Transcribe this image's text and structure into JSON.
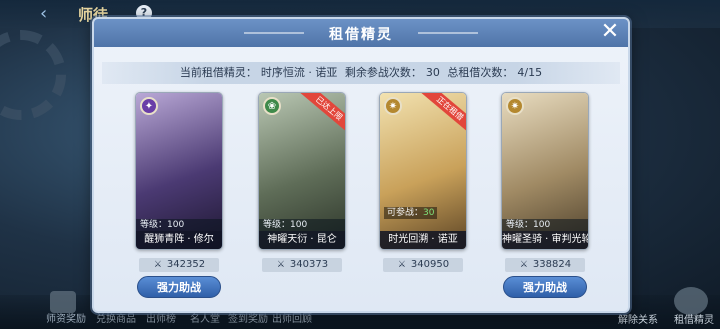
{
  "background": {
    "title": "师徒",
    "help": "?",
    "back_glyph": "‹",
    "bottom_items": [
      "师资奖励",
      "兑换商品",
      "出师榜",
      "名人堂",
      "签到奖励",
      "出师回顾"
    ],
    "right_label": "租借精灵",
    "right_label2": "解除关系"
  },
  "dialog": {
    "title": "租借精灵",
    "close": "✕",
    "info": {
      "current_label": "当前租借精灵：",
      "current_value": "时序恒流 · 诺亚",
      "remaining_label": "剩余参战次数：",
      "remaining_value": "30",
      "total_label": "总租借次数：",
      "total_value": "4/15"
    }
  },
  "cards": [
    {
      "name": "醒狮青阵 · 修尔",
      "level": "等级：100",
      "power": "342352",
      "element_icon": "shadow-element-icon",
      "element_color": "#6a3ea8",
      "element_glyph": "✦",
      "art_colors": [
        "#b9a8d6",
        "#4b3a73",
        "#1d1730"
      ],
      "ribbon": "",
      "can_battle": "",
      "can_battle_value": "",
      "button": "强力助战"
    },
    {
      "name": "神曜天衍 · 昆仑",
      "level": "等级：100",
      "power": "340373",
      "element_icon": "nature-element-icon",
      "element_color": "#3f8a4a",
      "element_glyph": "❀",
      "art_colors": [
        "#b9c7b3",
        "#5f6d58",
        "#2b3328"
      ],
      "ribbon": "已达上限",
      "can_battle": "",
      "can_battle_value": "",
      "button": ""
    },
    {
      "name": "时光回溯 · 诺亚",
      "level": "",
      "power": "340950",
      "element_icon": "light-element-icon",
      "element_color": "#b4882f",
      "element_glyph": "✷",
      "art_colors": [
        "#f2e2b0",
        "#c9a15a",
        "#5c4425"
      ],
      "ribbon": "正在租借",
      "can_battle": "可参战：",
      "can_battle_value": "30",
      "button": ""
    },
    {
      "name": "神曜圣骑 · 审判光轮",
      "level": "等级：100",
      "power": "338824",
      "element_icon": "light-element-icon",
      "element_color": "#b4882f",
      "element_glyph": "✷",
      "art_colors": [
        "#e8dcc0",
        "#a08a64",
        "#4b3e2a"
      ],
      "ribbon": "",
      "can_battle": "",
      "can_battle_value": "",
      "button": "强力助战"
    }
  ]
}
